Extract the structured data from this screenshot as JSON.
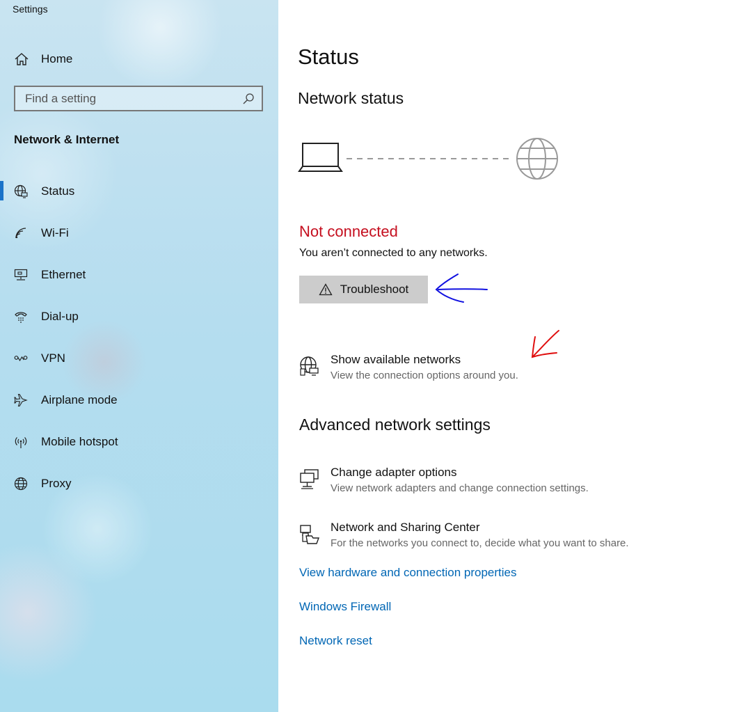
{
  "window": {
    "title": "Settings"
  },
  "sidebar": {
    "home_label": "Home",
    "search": {
      "placeholder": "Find a setting"
    },
    "section_title": "Network & Internet",
    "items": [
      {
        "label": "Status",
        "icon": "globe-status-icon",
        "active": true
      },
      {
        "label": "Wi-Fi",
        "icon": "wifi-icon"
      },
      {
        "label": "Ethernet",
        "icon": "ethernet-icon"
      },
      {
        "label": "Dial-up",
        "icon": "dialup-icon"
      },
      {
        "label": "VPN",
        "icon": "vpn-icon"
      },
      {
        "label": "Airplane mode",
        "icon": "airplane-icon"
      },
      {
        "label": "Mobile hotspot",
        "icon": "hotspot-icon"
      },
      {
        "label": "Proxy",
        "icon": "globe-icon"
      }
    ]
  },
  "main": {
    "page_title": "Status",
    "network_status_heading": "Network status",
    "connection": {
      "status": "Not connected",
      "description": "You aren’t connected to any networks.",
      "troubleshoot_label": "Troubleshoot"
    },
    "show_networks": {
      "title": "Show available networks",
      "description": "View the connection options around you."
    },
    "advanced_heading": "Advanced network settings",
    "advanced_items": [
      {
        "title": "Change adapter options",
        "description": "View network adapters and change connection settings.",
        "icon": "adapter-icon"
      },
      {
        "title": "Network and Sharing Center",
        "description": "For the networks you connect to, decide what you want to share.",
        "icon": "sharing-center-icon"
      }
    ],
    "links": [
      "View hardware and connection properties",
      "Windows Firewall",
      "Network reset"
    ]
  },
  "colors": {
    "accent": "#1a73c9",
    "error": "#c50f1f",
    "link": "#0066b4",
    "button_bg": "#cccccc",
    "annotation_blue": "#1010e0",
    "annotation_red": "#e01010"
  }
}
